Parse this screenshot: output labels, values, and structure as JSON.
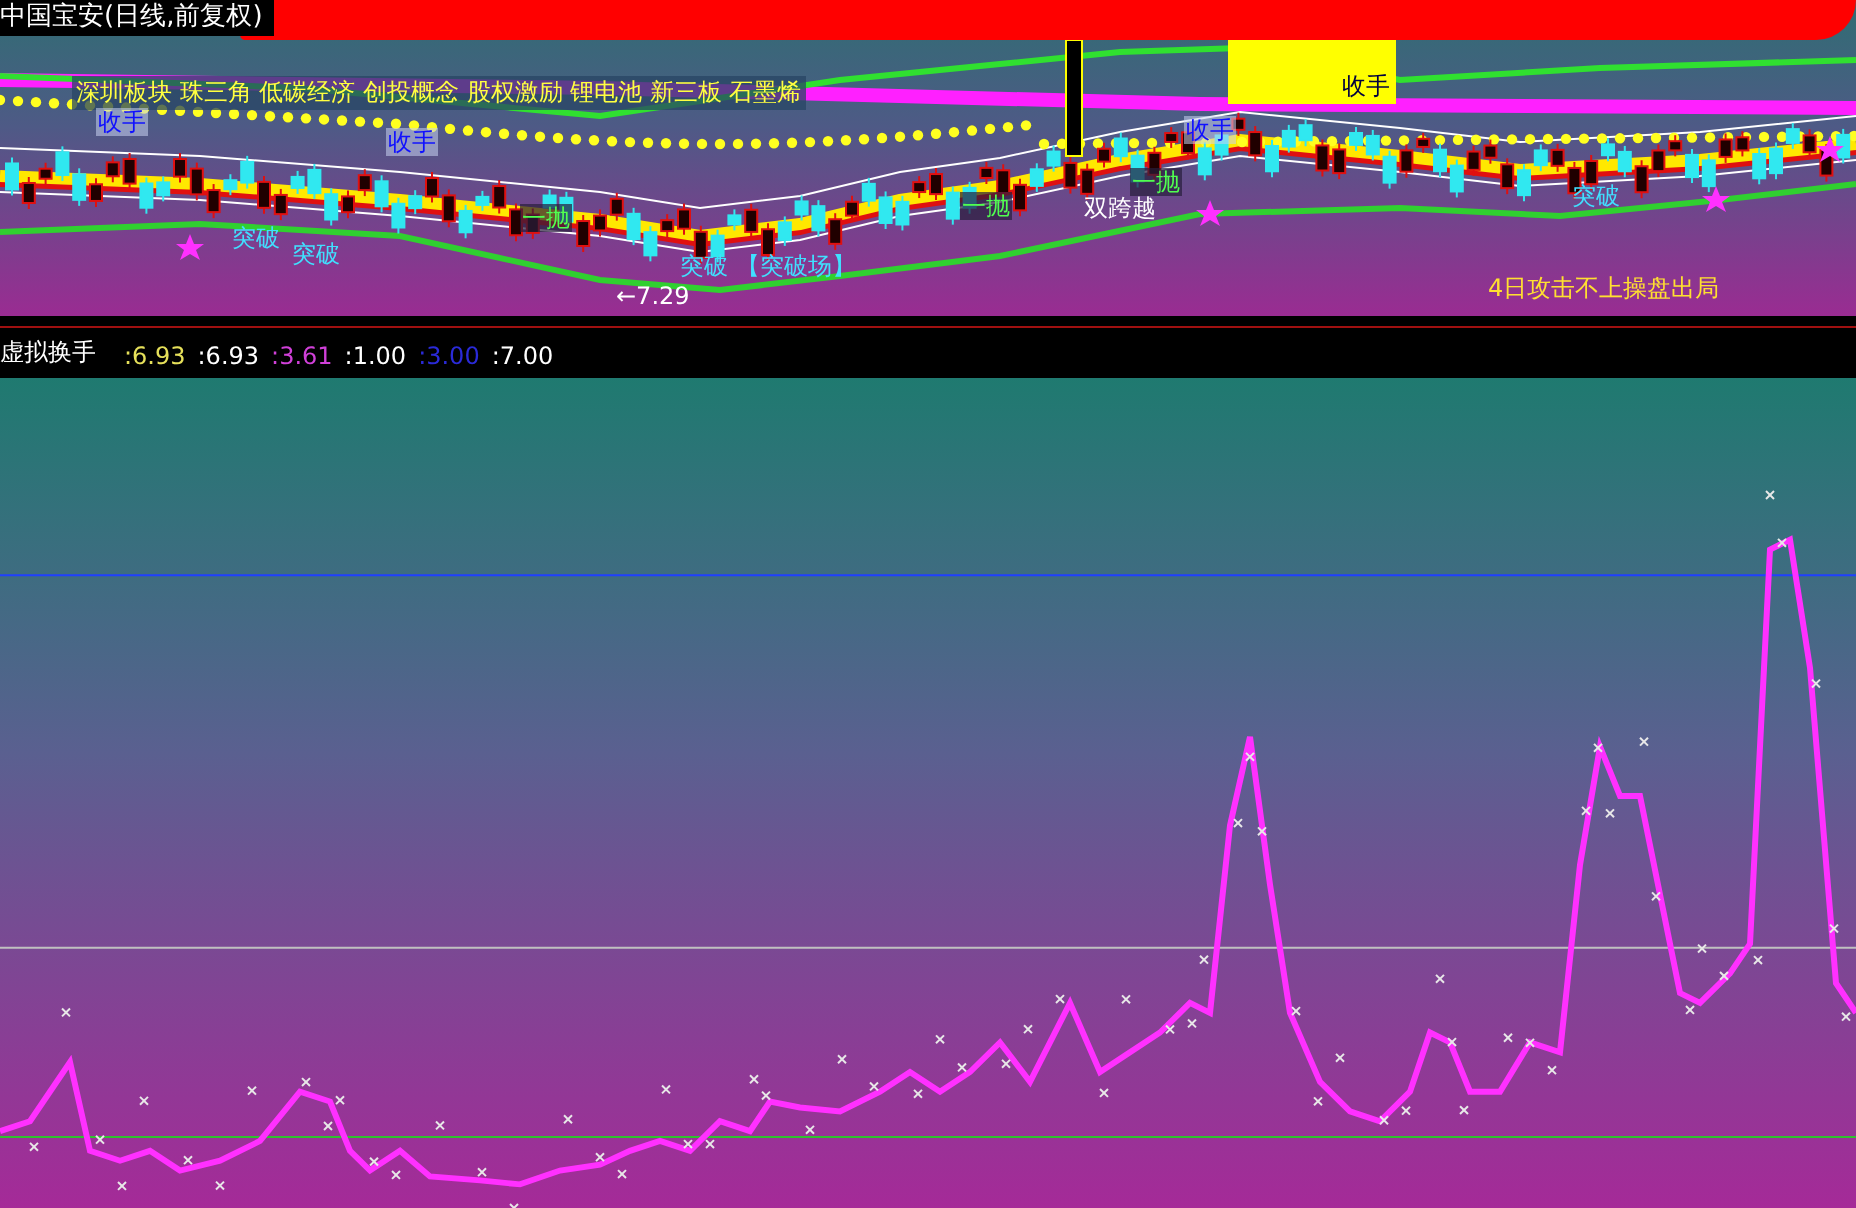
{
  "header": {
    "title": "中国宝安(日线,前复权)"
  },
  "sector_tags": "深圳板块 珠三角 低碳经济 创投概念 股权激励 锂电池 新三板 石墨烯",
  "chart_labels": [
    {
      "text": "收手",
      "kind": "exit"
    },
    {
      "text": "收手",
      "kind": "exit"
    },
    {
      "text": "收手",
      "kind": "exit"
    },
    {
      "text": "收手",
      "kind": "exit_dark"
    },
    {
      "text": "突破",
      "kind": "breakout"
    },
    {
      "text": "突破",
      "kind": "breakout"
    },
    {
      "text": "突破",
      "kind": "breakout"
    },
    {
      "text": "【突破场】",
      "kind": "breakout"
    },
    {
      "text": "←7.29",
      "kind": "price"
    },
    {
      "text": "一抛",
      "kind": "sell"
    },
    {
      "text": "一抛",
      "kind": "sell"
    },
    {
      "text": "一抛",
      "kind": "sell"
    },
    {
      "text": "双跨越",
      "kind": "cross"
    },
    {
      "text": "突破",
      "kind": "breakout"
    },
    {
      "text": "4日攻击不上操盘出局",
      "kind": "warning"
    }
  ],
  "indicator": {
    "name": "虚拟换手",
    "values": [
      {
        "text": ":6.93",
        "color": "#e6e05a"
      },
      {
        "text": ":6.93",
        "color": "#ffffff"
      },
      {
        "text": ":3.61",
        "color": "#d040d8"
      },
      {
        "text": ":1.00",
        "color": "#ffffff"
      },
      {
        "text": ":3.00",
        "color": "#2a2ad8"
      },
      {
        "text": ":7.00",
        "color": "#ffffff"
      }
    ]
  }
}
